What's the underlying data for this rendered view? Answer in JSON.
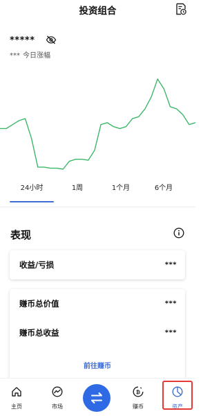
{
  "header": {
    "title": "投资组合",
    "history_icon": "history-doc-icon"
  },
  "balance": {
    "masked_value": "*****",
    "visibility_icon": "eye-off-icon"
  },
  "today": {
    "masked_change": "***",
    "label": "今日涨幅"
  },
  "chart_data": {
    "type": "line",
    "color": "#3db86a",
    "x": [
      0,
      1,
      2,
      3,
      4,
      5,
      6,
      7,
      8,
      9,
      10,
      11,
      12,
      13,
      14,
      15,
      16,
      17,
      18,
      19,
      20,
      21,
      22,
      23,
      24,
      25,
      26,
      27,
      28,
      29,
      30,
      31
    ],
    "y": [
      52,
      52,
      56,
      60,
      62,
      42,
      13,
      13,
      12,
      12,
      11,
      19,
      21,
      21,
      20,
      30,
      56,
      58,
      54,
      52,
      54,
      62,
      64,
      72,
      84,
      102,
      92,
      74,
      72,
      66,
      56,
      58
    ],
    "xlabel": "",
    "ylabel": "",
    "grid": false
  },
  "time_tabs": [
    {
      "label": "24小时",
      "active": true
    },
    {
      "label": "1周",
      "active": false
    },
    {
      "label": "1个月",
      "active": false
    },
    {
      "label": "6个月",
      "active": false
    }
  ],
  "performance": {
    "title": "表现",
    "info_icon": "info-icon",
    "profit_loss": {
      "label": "收益/亏损",
      "value": "***"
    },
    "earn_total_value": {
      "label": "赚币总价值",
      "value": "***"
    },
    "earn_total_profit": {
      "label": "赚币总收益",
      "value": "***"
    },
    "go_earn_label": "前往赚币"
  },
  "bottom_nav": {
    "home": {
      "label": "主页",
      "icon": "home-icon"
    },
    "market": {
      "label": "市场",
      "icon": "chart-circle-icon"
    },
    "swap": {
      "icon": "swap-arrows-icon",
      "color": "#2d6ae3"
    },
    "earn": {
      "label": "赚币",
      "icon": "bitcoin-circle-icon"
    },
    "assets": {
      "label": "资产",
      "icon": "pie-chart-icon",
      "active": true
    }
  },
  "colors": {
    "accent": "#3f6fd6",
    "chart_line": "#3db86a",
    "highlight": "#e53935"
  }
}
